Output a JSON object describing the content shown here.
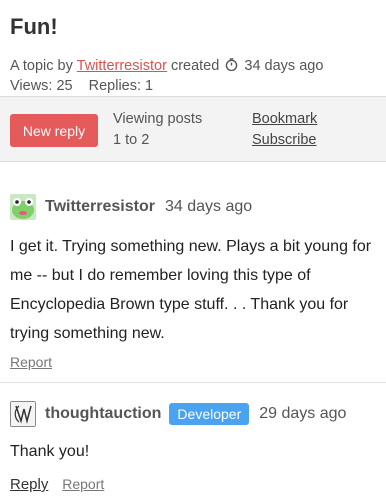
{
  "topic": {
    "title": "Fun!",
    "meta_prefix": "A topic by",
    "author": "Twitterresistor",
    "meta_created": "created",
    "created_ago": "34 days ago",
    "views": "Views: 25",
    "replies": "Replies: 1"
  },
  "action_bar": {
    "new_reply_label": "New reply",
    "viewing_line1": "Viewing posts",
    "viewing_line2": "1 to 2",
    "bookmark_label": "Bookmark",
    "subscribe_label": "Subscribe"
  },
  "posts": [
    {
      "username": "Twitterresistor",
      "date": "34 days ago",
      "body_lines": [
        "I get it.  Trying something new.  Plays a bit young for",
        "me -- but I do remember loving this type of",
        "Encyclopedia Brown type stuff. . . Thank you for",
        "trying something new."
      ],
      "report_label": "Report"
    },
    {
      "username": "thoughtauction",
      "badge": "Developer",
      "date": "29 days ago",
      "body_lines": [
        "Thank you!"
      ],
      "reply_label": "Reply",
      "report_label": "Report"
    }
  ],
  "colors": {
    "accent_red": "#e55b5b",
    "badge_blue": "#4aa3f0",
    "link_red": "#d9534f"
  }
}
